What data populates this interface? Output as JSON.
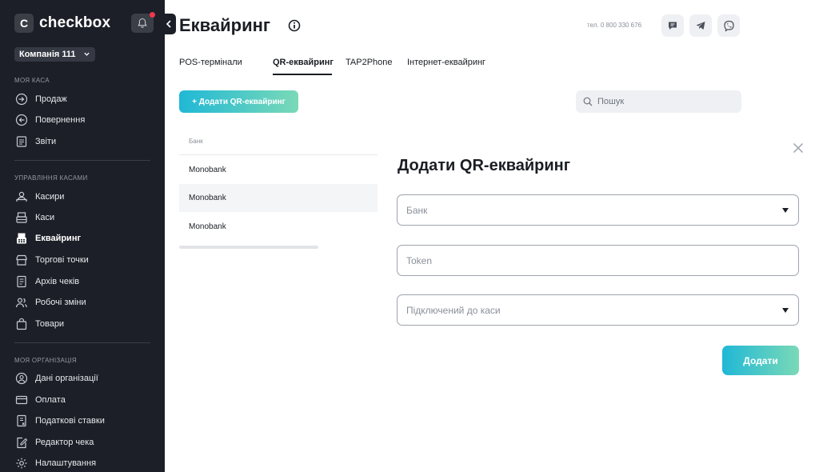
{
  "app": {
    "logo_letter": "C",
    "logo_text": "checkbox",
    "company": "Компанія 111"
  },
  "sidebar": {
    "sections": [
      {
        "title": "МОЯ КАСА",
        "items": [
          {
            "label": "Продаж",
            "icon": "sale-arrow-icon"
          },
          {
            "label": "Повернення",
            "icon": "return-arrow-icon"
          },
          {
            "label": "Звіти",
            "icon": "reports-icon"
          }
        ]
      },
      {
        "title": "УПРАВЛІННЯ КАСАМИ",
        "items": [
          {
            "label": "Касири",
            "icon": "cashiers-icon"
          },
          {
            "label": "Каси",
            "icon": "cash-register-icon"
          },
          {
            "label": "Еквайринг",
            "icon": "acquiring-icon",
            "active": true
          },
          {
            "label": "Торгові точки",
            "icon": "store-icon"
          },
          {
            "label": "Архів чеків",
            "icon": "receipt-archive-icon"
          },
          {
            "label": "Робочі зміни",
            "icon": "shifts-icon"
          },
          {
            "label": "Товари",
            "icon": "goods-bag-icon"
          }
        ]
      },
      {
        "title": "МОЯ ОРГАНІЗАЦІЯ",
        "items": [
          {
            "label": "Дані організації",
            "icon": "organization-icon"
          },
          {
            "label": "Оплата",
            "icon": "payment-card-icon"
          },
          {
            "label": "Податкові ставки",
            "icon": "tax-rates-icon"
          },
          {
            "label": "Редактор чека",
            "icon": "receipt-editor-icon"
          },
          {
            "label": "Налаштування",
            "icon": "settings-gear-icon"
          }
        ]
      }
    ]
  },
  "header": {
    "title": "Еквайринг",
    "phone": "тел. 0 800 330 676"
  },
  "tabs": [
    {
      "label": "POS-термінали"
    },
    {
      "label": "QR-еквайринг",
      "active": true
    },
    {
      "label": "TAP2Phone"
    },
    {
      "label": "Інтернет-еквайринг"
    }
  ],
  "toolbar": {
    "add_button": "+ Додати QR-еквайринг",
    "search_placeholder": "Пошук"
  },
  "table": {
    "header": "Банк",
    "rows": [
      "Monobank",
      "Monobank",
      "Monobank"
    ]
  },
  "panel": {
    "title": "Додати QR-еквайринг",
    "bank_placeholder": "Банк",
    "token_placeholder": "Token",
    "register_placeholder": "Підключений до каси",
    "submit": "Додати"
  },
  "colors": {
    "sidebar_bg": "#1c1f27",
    "accent_start": "#20b8d6",
    "accent_end": "#7ad9b7",
    "notification_dot": "#f0384b"
  }
}
